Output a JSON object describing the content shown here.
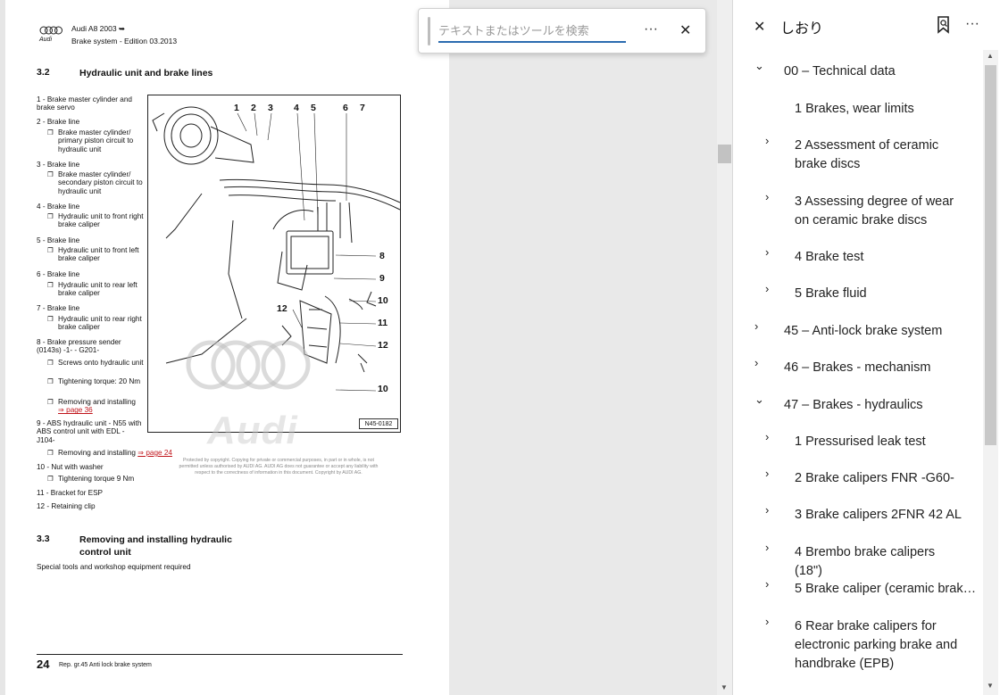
{
  "document": {
    "header": {
      "line1": "Audi A8 2003 ➥",
      "line2": "Brake system - Edition 03.2013",
      "brand": "Audi"
    },
    "section_32": {
      "number": "3.2",
      "title": "Hydraulic unit and brake lines"
    },
    "legend": [
      "1 - Brake master cylinder and brake servo",
      "2 - Brake line",
      "Brake master cylinder/ primary piston circuit to hydraulic unit",
      "3 - Brake line",
      "Brake master cylinder/ secondary piston circuit to hydraulic unit",
      "4 - Brake line",
      "Hydraulic unit to front right brake caliper",
      "5 - Brake line",
      "Hydraulic unit to front left brake caliper",
      "6 - Brake line",
      "Hydraulic unit to rear left brake caliper",
      "7 - Brake line",
      "Hydraulic unit to rear right brake caliper",
      "8 - Brake pressure sender (0143s) -1- - G201-",
      "Screws onto hydraulic unit",
      "Tightening torque: 20 Nm",
      "Removing and installing",
      "⇒ page 36",
      "9 - ABS hydraulic unit - N55 with ABS control unit with EDL - J104-",
      "Removing and installing",
      "⇒ page 24",
      "10 - Nut with washer",
      "Tightening torque 9 Nm",
      "11 - Bracket for ESP",
      "12 - Retaining clip"
    ],
    "callouts": [
      "1",
      "2",
      "3",
      "4",
      "5",
      "6",
      "7",
      "8",
      "9",
      "10",
      "11",
      "12",
      "12",
      "10"
    ],
    "figure_code": "N45-0182",
    "watermark": "Audi",
    "copyright": "Protected by copyright. Copying for private or commercial purposes, in part or in whole, is not permitted unless authorised by AUDI AG. AUDI AG does not guarantee or accept any liability with respect to the correctness of information in this document. Copyright by AUDI AG.",
    "section_33": {
      "number": "3.3",
      "title": "Removing and installing hydraulic control unit"
    },
    "special_tools": "Special tools and workshop equipment required",
    "footer": {
      "page_number": "24",
      "text": "Rep. gr.45 Anti lock brake system"
    }
  },
  "search": {
    "placeholder": "テキストまたはツールを検索",
    "value": "",
    "more_label": "···",
    "close_label": "✕"
  },
  "panel": {
    "title": "しおり",
    "close_label": "✕",
    "more_label": "···",
    "items": [
      {
        "label": "00 – Technical data",
        "chevron": "⌄"
      },
      {
        "label": "1 Brakes, wear limits",
        "chevron": ""
      },
      {
        "label": "2 Assessment of ceramic brake discs",
        "chevron": "›"
      },
      {
        "label": "3 Assessing degree of wear on ceramic brake discs",
        "chevron": "›"
      },
      {
        "label": "4 Brake test",
        "chevron": "›"
      },
      {
        "label": "5 Brake fluid",
        "chevron": "›"
      },
      {
        "label": "45 – Anti-lock brake system",
        "chevron": "›"
      },
      {
        "label": "46 – Brakes - mechanism",
        "chevron": "›"
      },
      {
        "label": "47 – Brakes - hydraulics",
        "chevron": "⌄"
      },
      {
        "label": "1 Pressurised leak test",
        "chevron": "›"
      },
      {
        "label": "2 Brake calipers FNR -G60-",
        "chevron": "›"
      },
      {
        "label": "3 Brake calipers 2FNR 42 AL",
        "chevron": "›"
      },
      {
        "label": "4 Brembo brake calipers (18\")",
        "chevron": "›"
      },
      {
        "label": "5 Brake caliper (ceramic brak…",
        "chevron": "›"
      },
      {
        "label": "6 Rear brake calipers for electronic parking brake and handbrake (EPB)",
        "chevron": "›"
      }
    ]
  },
  "colors": {
    "link": "#c0141b",
    "accent": "#2b6cb0"
  }
}
